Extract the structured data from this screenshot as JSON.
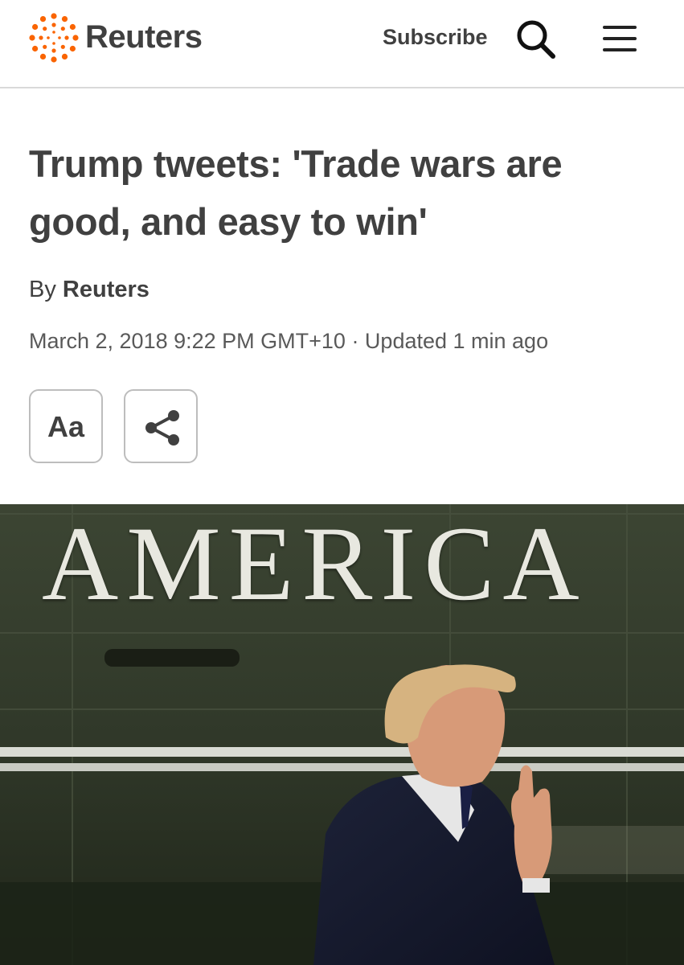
{
  "header": {
    "brand": "Reuters",
    "subscribe_label": "Subscribe",
    "search_icon": "search-icon",
    "menu_icon": "hamburger-menu-icon",
    "accent_color": "#fa6400"
  },
  "article": {
    "headline": "Trump tweets: 'Trade wars are good, and easy to win'",
    "byline_prefix": "By",
    "byline_author": "Reuters",
    "dateline": "March 2, 2018 9:22 PM GMT+10 · Updated 1 min ago"
  },
  "tools": {
    "text_size_label": "Aa",
    "share_icon": "share-icon"
  },
  "hero_image": {
    "text_in_photo": "AMERICA"
  }
}
